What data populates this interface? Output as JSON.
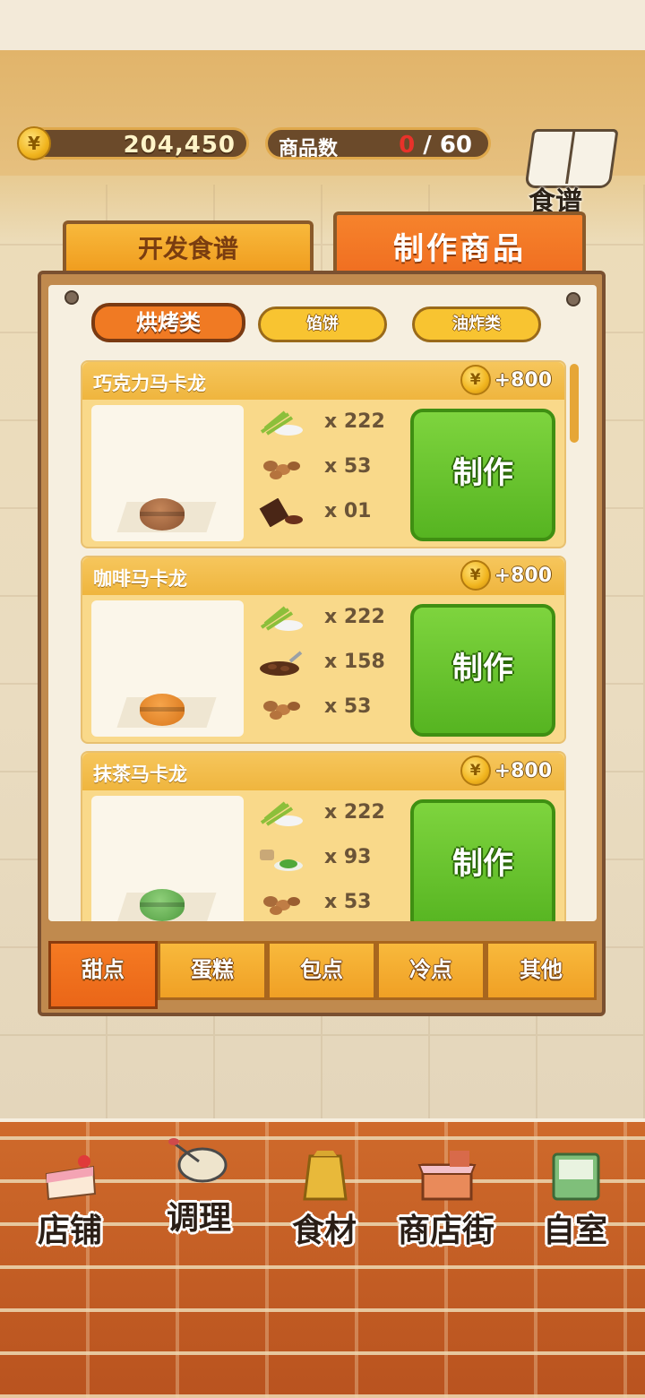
{
  "header": {
    "coin_symbol": "¥",
    "coins": "204,450",
    "goods_label": "商品数",
    "goods_current": "0",
    "goods_sep": " / 60",
    "recipe_book_label": "食谱"
  },
  "tabs": {
    "develop": "开发食谱",
    "make": "制作商品"
  },
  "subtabs": {
    "bake": "烘烤类",
    "pie": "馅饼",
    "fry": "油炸类"
  },
  "products": [
    {
      "name": "巧克力马卡龙",
      "reward": "+800",
      "ingredients": [
        {
          "icon": "sugar-cane-icon",
          "qty": "x 222"
        },
        {
          "icon": "almonds-icon",
          "qty": "x 53"
        },
        {
          "icon": "chocolate-icon",
          "qty": "x 01"
        }
      ],
      "button": "制作"
    },
    {
      "name": "咖啡马卡龙",
      "reward": "+800",
      "ingredients": [
        {
          "icon": "sugar-cane-icon",
          "qty": "x 222"
        },
        {
          "icon": "coffee-beans-icon",
          "qty": "x 158"
        },
        {
          "icon": "almonds-icon",
          "qty": "x 53"
        }
      ],
      "button": "制作"
    },
    {
      "name": "抹茶马卡龙",
      "reward": "+800",
      "ingredients": [
        {
          "icon": "sugar-cane-icon",
          "qty": "x 222"
        },
        {
          "icon": "matcha-powder-icon",
          "qty": "x 93"
        },
        {
          "icon": "almonds-icon",
          "qty": "x 53"
        }
      ],
      "button": "制作"
    }
  ],
  "categories": [
    "甜点",
    "蛋糕",
    "包点",
    "冷点",
    "其他"
  ],
  "nav": [
    "店铺",
    "调理",
    "食材",
    "商店街",
    "自室"
  ],
  "colors": {
    "accent": "#f07a23",
    "make_button": "#56b421",
    "coin": "#f1b51f"
  }
}
